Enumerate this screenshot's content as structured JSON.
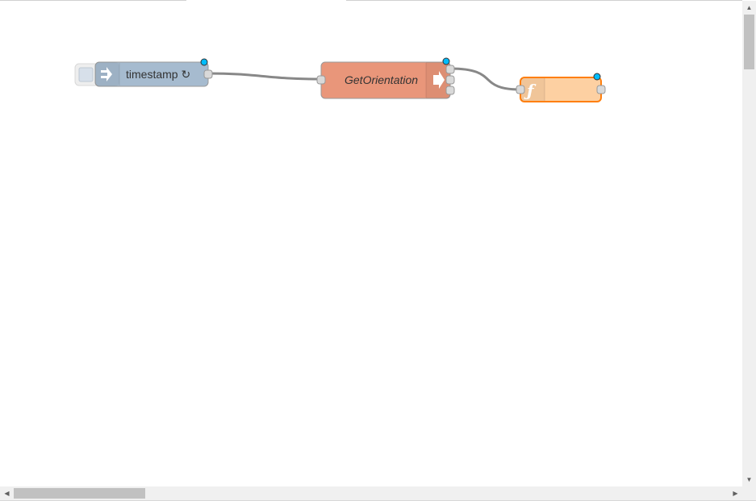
{
  "nodes": {
    "inject": {
      "label": "timestamp ↻",
      "icon": "arrow-in-icon",
      "color": "#a6bbcf"
    },
    "subflow": {
      "label": "GetOrientation",
      "icon": "arrow-out-icon",
      "color": "#e9967a"
    },
    "function": {
      "label": "",
      "icon": "function-icon",
      "color": "#fdd0a2",
      "border_color": "#ff7f0e"
    }
  },
  "colors": {
    "changed_indicator": "#00bcff",
    "wire": "#888888",
    "port_fill": "#d9d9d9"
  },
  "scrollbars": {
    "up_arrow": "▲",
    "down_arrow": "▼",
    "left_arrow": "◀",
    "right_arrow": "▶"
  }
}
